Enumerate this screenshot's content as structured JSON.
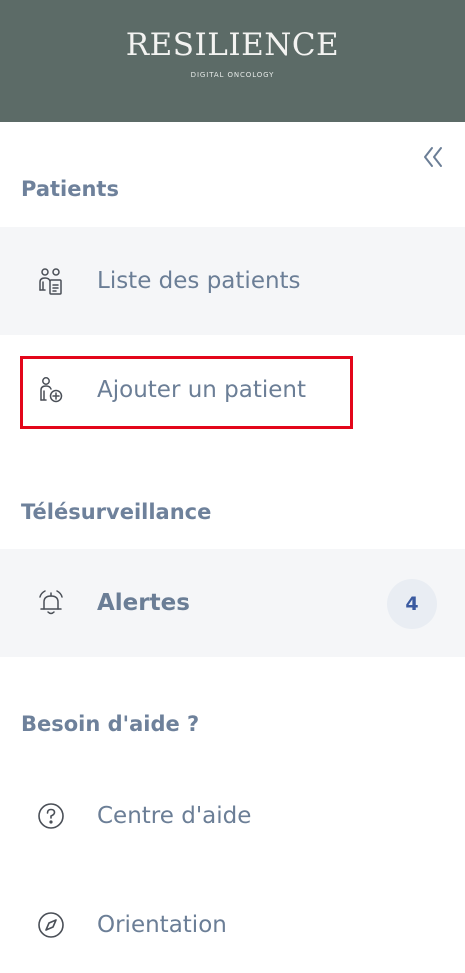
{
  "brand": {
    "name": "RESILIENCE",
    "tagline": "DIGITAL ONCOLOGY"
  },
  "sections": {
    "patients": {
      "title": "Patients",
      "items": [
        {
          "label": "Liste des patients",
          "icon": "patient-list-icon"
        },
        {
          "label": "Ajouter un patient",
          "icon": "add-patient-icon"
        }
      ]
    },
    "telesurveillance": {
      "title": "Télésurveillance",
      "items": [
        {
          "label": "Alertes",
          "icon": "bell-icon",
          "count": "4"
        }
      ]
    },
    "aide": {
      "title": "Besoin d'aide ?",
      "items": [
        {
          "label": "Centre d'aide",
          "icon": "help-circle-icon"
        },
        {
          "label": "Orientation",
          "icon": "compass-icon"
        }
      ]
    }
  },
  "colors": {
    "brand_bg": "#5c6b67",
    "text": "#6b7e96",
    "section_title": "#6e819b",
    "highlight": "#e3061a",
    "badge_bg": "#e9edf3",
    "badge_text": "#3a5aa0",
    "shaded_row": "#f5f6f8"
  }
}
